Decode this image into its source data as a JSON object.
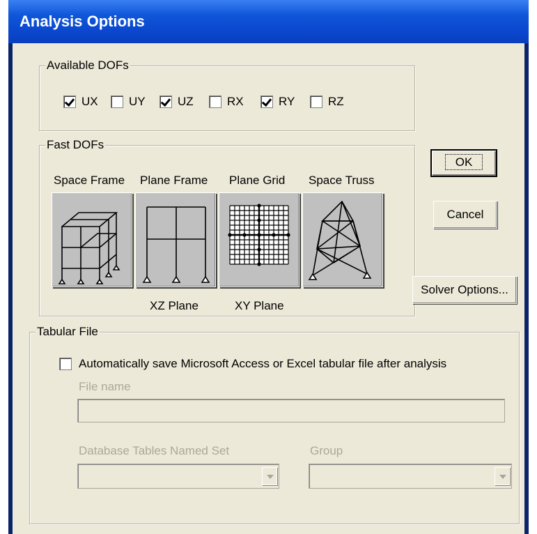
{
  "window": {
    "title": "Analysis Options"
  },
  "available_dofs": {
    "title": "Available DOFs",
    "items": [
      {
        "label": "UX",
        "checked": true
      },
      {
        "label": "UY",
        "checked": false
      },
      {
        "label": "UZ",
        "checked": true
      },
      {
        "label": "RX",
        "checked": false
      },
      {
        "label": "RY",
        "checked": true
      },
      {
        "label": "RZ",
        "checked": false
      }
    ]
  },
  "fast_dofs": {
    "title": "Fast DOFs",
    "options": [
      {
        "label": "Space Frame",
        "sublabel": "",
        "icon": "space-frame-icon"
      },
      {
        "label": "Plane Frame",
        "sublabel": "XZ Plane",
        "icon": "plane-frame-icon"
      },
      {
        "label": "Plane Grid",
        "sublabel": "XY Plane",
        "icon": "plane-grid-icon"
      },
      {
        "label": "Space Truss",
        "sublabel": "",
        "icon": "space-truss-icon"
      }
    ]
  },
  "buttons": {
    "ok": "OK",
    "cancel": "Cancel",
    "solver": "Solver Options..."
  },
  "tabular_file": {
    "title": "Tabular File",
    "auto_save_label": "Automatically save Microsoft Access or Excel tabular file after analysis",
    "auto_save_checked": false,
    "file_name_label": "File name",
    "file_name_value": "",
    "db_tables_label": "Database Tables Named Set",
    "db_tables_value": "",
    "group_label": "Group",
    "group_value": ""
  },
  "colors": {
    "title_bar": "#0b48cf",
    "dialog_bg": "#ece9d8",
    "disabled_text": "#aca899"
  }
}
